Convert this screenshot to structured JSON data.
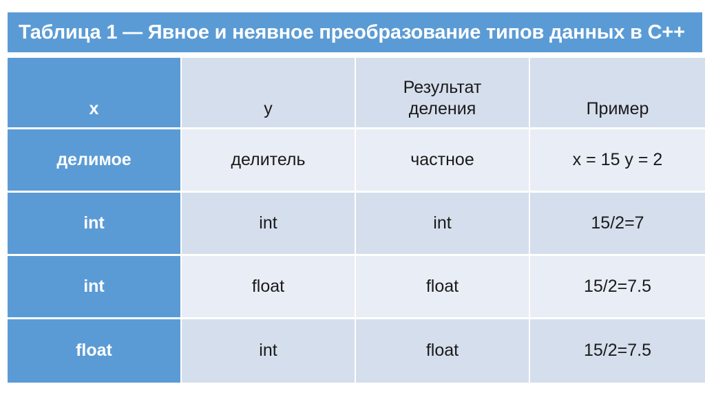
{
  "slide": {
    "title": "Таблица 1 — Явное и неявное преобразование типов данных в C++",
    "accent_color": "#5B9BD5",
    "header_cell_color": "#D5DEEC",
    "row_light_color": "#E9EDF5",
    "row_dark_color": "#D5DEEC",
    "key_column_text_color": "#FFFFFF",
    "body_text_color": "#1A1A1A"
  },
  "table": {
    "columns": [
      {
        "label": "x",
        "lines": [
          "x"
        ]
      },
      {
        "label": "y",
        "lines": [
          "y"
        ]
      },
      {
        "label": "Результат деления",
        "lines": [
          "Результат",
          "деления"
        ]
      },
      {
        "label": "Пример",
        "lines": [
          "Пример"
        ]
      }
    ],
    "rows": [
      {
        "shade": "light",
        "cells": [
          "делимое",
          "делитель",
          "частное",
          "x = 15 y = 2"
        ]
      },
      {
        "shade": "dark",
        "cells": [
          "int",
          "int",
          "int",
          "15/2=7"
        ]
      },
      {
        "shade": "light",
        "cells": [
          "int",
          "float",
          "float",
          "15/2=7.5"
        ]
      },
      {
        "shade": "dark",
        "cells": [
          "float",
          "int",
          "float",
          "15/2=7.5"
        ]
      }
    ]
  }
}
